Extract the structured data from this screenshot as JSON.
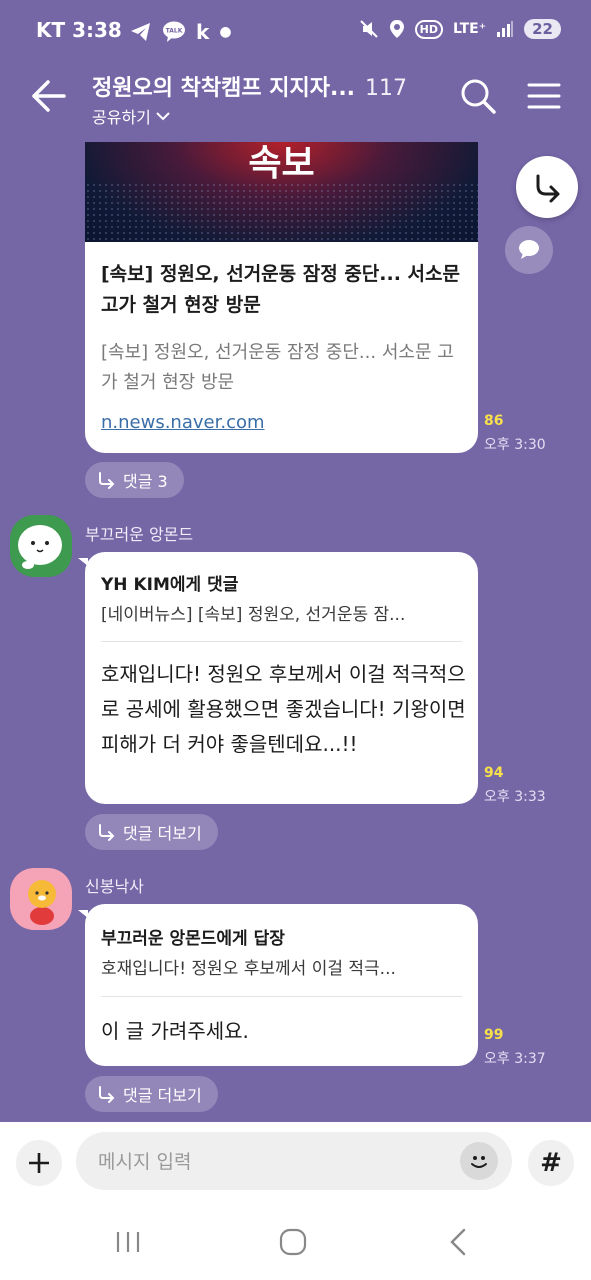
{
  "status_bar": {
    "carrier_time": "KT 3:38",
    "notif_icons": "telegram-icon talk-icon k-icon dot",
    "k_label": "k",
    "talk_label": "TALK",
    "hd_label": "HD",
    "lte_label": "LTE⁺",
    "battery": "22"
  },
  "header": {
    "title": "정원오의 착착캠프 지지자...",
    "member_count": "117",
    "share_label": "공유하기"
  },
  "link_card": {
    "thumbnail_text": "속보",
    "title": "[속보] 정원오, 선거운동 잠정 중단... 서소문 고가 철거 현장 방문",
    "description": "[속보] 정원오, 선거운동 잠정 중단... 서소문 고가 철거 현장 방문",
    "link": "n.news.naver.com",
    "unread": "86",
    "time": "오후 3:30",
    "reply_label": "댓글 3"
  },
  "messages": [
    {
      "sender": "부끄러운 앙몬드",
      "reply_to": "YH KIM에게 댓글",
      "quote": "[네이버뉴스] [속보] 정원오, 선거운동 잠...",
      "text": "호재입니다! 정원오 후보께서 이걸 적극적으로 공세에 활용했으면 좋겠습니다! 기왕이면 피해가 더 커야 좋을텐데요...!!",
      "unread": "94",
      "time": "오후 3:33",
      "reply_label": "댓글 더보기"
    },
    {
      "sender": "신봉낙사",
      "reply_to": "부끄러운 앙몬드에게 답장",
      "quote": "호재입니다! 정원오 후보께서 이걸 적극...",
      "text": "이 글 가려주세요.",
      "unread": "99",
      "time": "오후 3:37",
      "reply_label": "댓글 더보기"
    }
  ],
  "input": {
    "placeholder": "메시지 입력",
    "hash_label": "#"
  },
  "colors": {
    "background": "#7566a6",
    "unread": "#f7e04a",
    "link": "#3a6ea8"
  }
}
